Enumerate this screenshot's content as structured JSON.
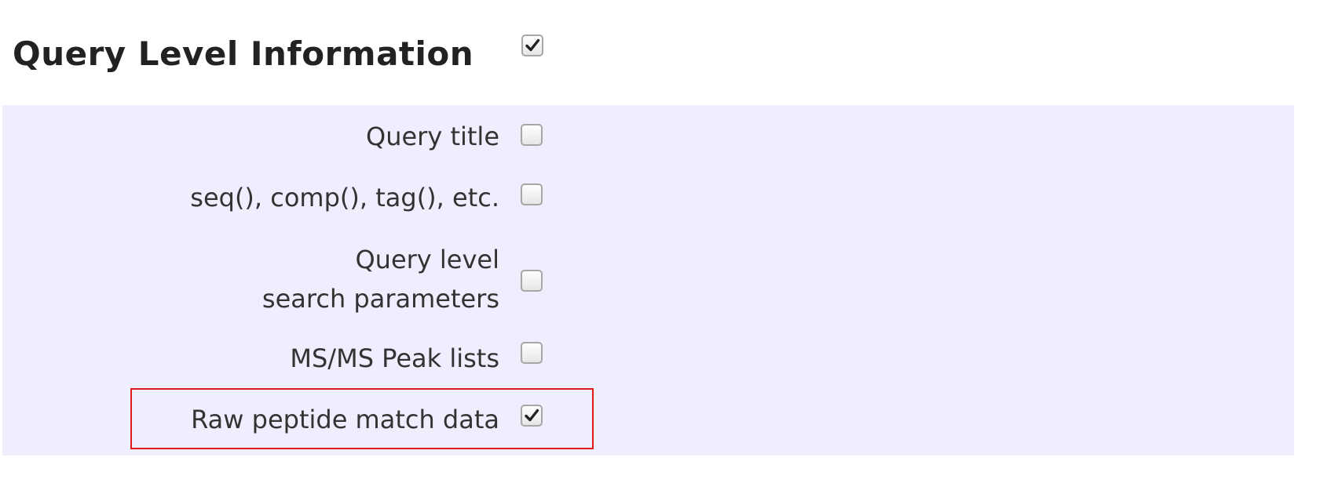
{
  "section": {
    "title": "Query Level Information",
    "checked": true
  },
  "options": [
    {
      "label": "Query title",
      "checked": false
    },
    {
      "label": "seq(), comp(), tag(), etc.",
      "checked": false
    },
    {
      "label_line1": "Query level",
      "label_line2": "search parameters",
      "checked": false
    },
    {
      "label": "MS/MS Peak lists",
      "checked": false
    },
    {
      "label": "Raw peptide match data",
      "checked": true
    }
  ],
  "colors": {
    "panel_background": "#eeeeff",
    "highlight_border": "#e01a1a"
  }
}
